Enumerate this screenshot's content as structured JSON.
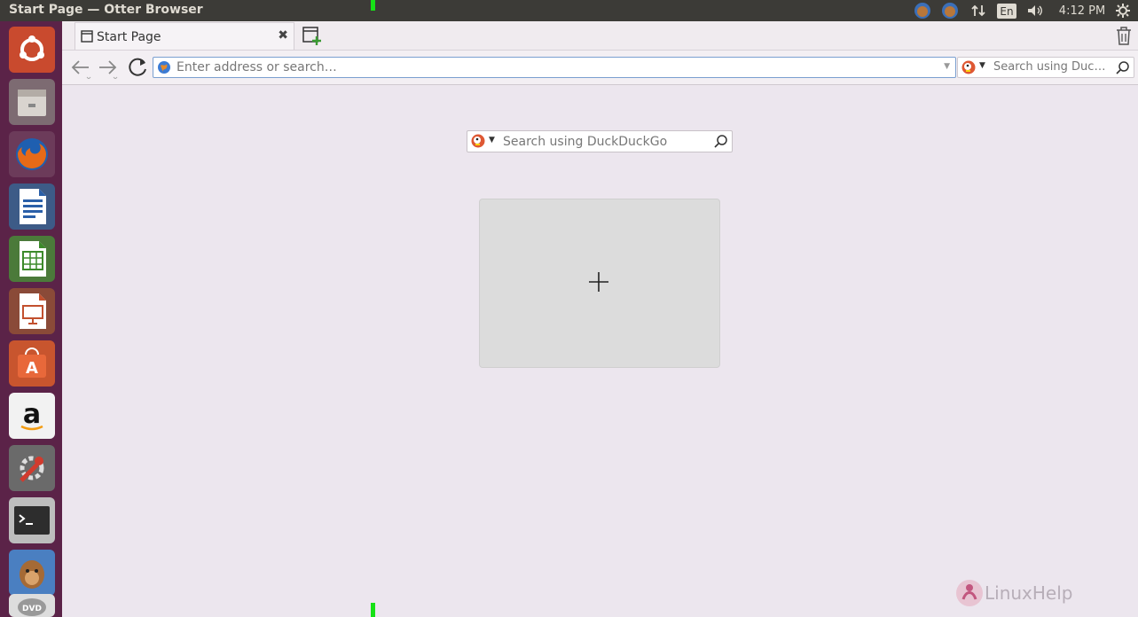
{
  "window": {
    "title": "Start Page — Otter Browser"
  },
  "panel": {
    "keyboard": "En",
    "time": "4:12 PM"
  },
  "tab": {
    "label": "Start Page"
  },
  "address_bar": {
    "placeholder": "Enter address or search…"
  },
  "toolbar_search": {
    "placeholder": "Search using Duc…"
  },
  "start_page": {
    "search_placeholder": "Search using DuckDuckGo"
  },
  "watermark": {
    "text": "LinuxHelp"
  },
  "launcher": {
    "items": [
      "ubuntu-dash",
      "files",
      "firefox",
      "libreoffice-writer",
      "libreoffice-calc",
      "libreoffice-impress",
      "ubuntu-software",
      "amazon",
      "system-settings",
      "terminal",
      "otter-browser",
      "dvd"
    ]
  },
  "colors": {
    "launcher_bg": "#5b2348",
    "panel_bg": "#3c3b37",
    "page_bg": "#ece6ee",
    "accent": "#e95420"
  }
}
